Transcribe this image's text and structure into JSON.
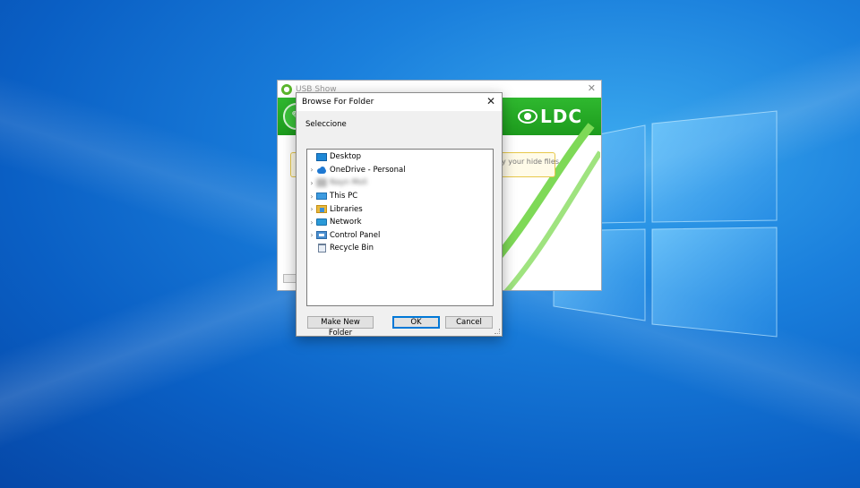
{
  "usb_window": {
    "title": "USB Show",
    "close_glyph": "✕",
    "brand_logo": "LDC",
    "hint_text": "y your hide files"
  },
  "dialog": {
    "title": "Browse For Folder",
    "close_glyph": "✕",
    "prompt": "Seleccione",
    "tree": [
      {
        "label": "Desktop",
        "icon": "desktop-icon",
        "expandable": false
      },
      {
        "label": "OneDrive - Personal",
        "icon": "onedrive-icon",
        "expandable": true
      },
      {
        "label": "Nayn Moli",
        "icon": "user-folder-icon",
        "expandable": true,
        "blurred": true
      },
      {
        "label": "This PC",
        "icon": "computer-icon",
        "expandable": true
      },
      {
        "label": "Libraries",
        "icon": "libraries-icon",
        "expandable": true
      },
      {
        "label": "Network",
        "icon": "network-icon",
        "expandable": true
      },
      {
        "label": "Control Panel",
        "icon": "control-panel-icon",
        "expandable": true
      },
      {
        "label": "Recycle Bin",
        "icon": "recycle-bin-icon",
        "expandable": false
      }
    ],
    "buttons": {
      "make_new_folder": "Make New Folder",
      "ok": "OK",
      "cancel": "Cancel"
    }
  },
  "colors": {
    "desktop_blue": "#0a5fc4",
    "usb_green": "#1d9b1d",
    "focus_blue": "#0078d7"
  }
}
